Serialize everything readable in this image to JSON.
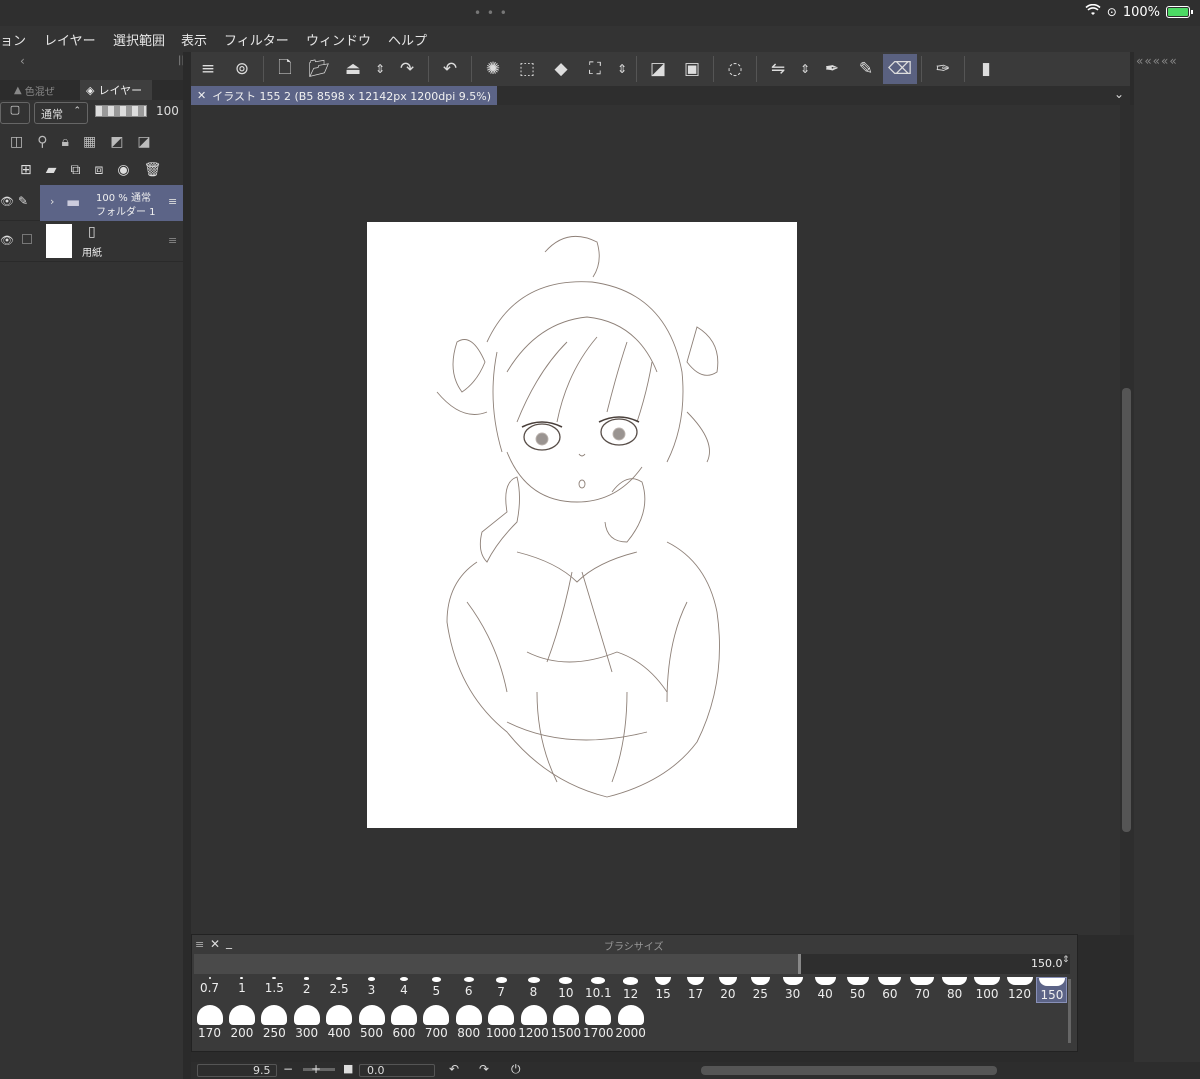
{
  "status": {
    "battery": "100%"
  },
  "menu": [
    "ョン",
    "レイヤー",
    "選択範囲",
    "表示",
    "フィルター",
    "ウィンドウ",
    "ヘルプ"
  ],
  "left_panel": {
    "tab_color_mix": "色混ぜ",
    "tab_layer": "レイヤー",
    "blend_mode": "通常",
    "opacity": "100",
    "layers": [
      {
        "percent_mode": "100 % 通常",
        "name": "フォルダー 1"
      },
      {
        "name": "用紙"
      }
    ]
  },
  "document": {
    "tab_title": "イラスト 155 2 (B5 8598 x 12142px 1200dpi 9.5%)"
  },
  "brush_panel": {
    "title": "ブラシサイズ",
    "value": "150.0",
    "row1": [
      "0.7",
      "1",
      "1.5",
      "2",
      "2.5",
      "3",
      "4",
      "5",
      "6",
      "7",
      "8",
      "10",
      "10.1",
      "12",
      "15",
      "17",
      "20",
      "25",
      "30",
      "40",
      "50",
      "60",
      "70",
      "80",
      "100",
      "120",
      "150"
    ],
    "row2": [
      "170",
      "200",
      "250",
      "300",
      "400",
      "500",
      "600",
      "700",
      "800",
      "1000",
      "1200",
      "1500",
      "1700",
      "2000"
    ],
    "selected": "150"
  },
  "bottom_bar": {
    "zoom": "9.5",
    "rotation": "0.0"
  },
  "colors": {
    "accent": "#5c6487",
    "panel": "#333333",
    "canvas": "#323232"
  }
}
